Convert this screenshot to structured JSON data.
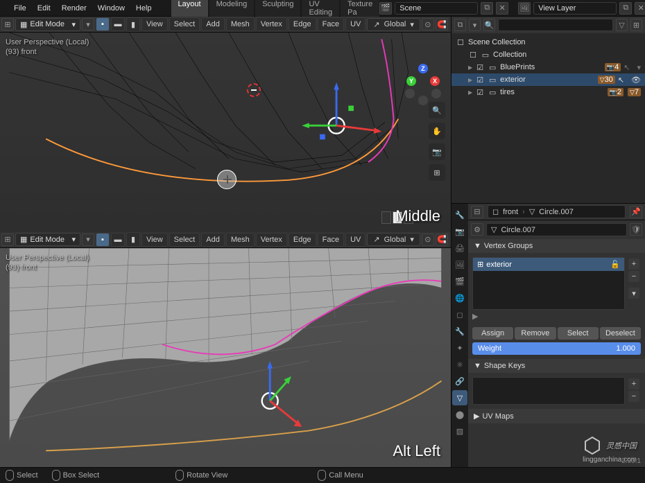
{
  "menus": [
    "File",
    "Edit",
    "Render",
    "Window",
    "Help"
  ],
  "workspaces": [
    "Layout",
    "Modeling",
    "Sculpting",
    "UV Editing",
    "Texture Pa"
  ],
  "active_workspace": "Layout",
  "scene_name": "Scene",
  "view_layer": "View Layer",
  "viewports": [
    {
      "mode": "Edit Mode",
      "header_menus": [
        "View",
        "Select",
        "Add",
        "Mesh",
        "Vertex",
        "Edge",
        "Face",
        "UV"
      ],
      "orientation": "Global",
      "overlay_line1": "User Perspective (Local)",
      "overlay_line2": "(93) front",
      "big_label": "Middle"
    },
    {
      "mode": "Edit Mode",
      "header_menus": [
        "View",
        "Select",
        "Add",
        "Mesh",
        "Vertex",
        "Edge",
        "Face",
        "UV"
      ],
      "orientation": "Global",
      "overlay_line1": "User Perspective (Local)",
      "overlay_line2": "(93) front",
      "big_label": "Alt Left"
    }
  ],
  "outliner": {
    "root": "Scene Collection",
    "collection": "Collection",
    "items": [
      {
        "name": "BluePrints",
        "badge": "4",
        "selected": false
      },
      {
        "name": "exterior",
        "badge": "30",
        "selected": true
      },
      {
        "name": "tires",
        "badge": "2",
        "badge2": "7",
        "selected": false
      }
    ]
  },
  "properties": {
    "breadcrumb_obj": "front",
    "breadcrumb_data": "Circle.007",
    "search": "Circle.007",
    "vertex_groups_label": "Vertex Groups",
    "vertex_groups": [
      "exterior"
    ],
    "buttons": {
      "assign": "Assign",
      "remove": "Remove",
      "select": "Select",
      "deselect": "Deselect"
    },
    "weight_label": "Weight",
    "weight_value": "1.000",
    "shape_keys_label": "Shape Keys",
    "uv_maps_label": "UV Maps"
  },
  "statusbar": {
    "select": "Select",
    "box_select": "Box Select",
    "rotate_view": "Rotate View",
    "call_menu": "Call Menu"
  },
  "version": "2.90.1",
  "watermark": "灵感中国",
  "watermark_url": "lingganchina.com"
}
